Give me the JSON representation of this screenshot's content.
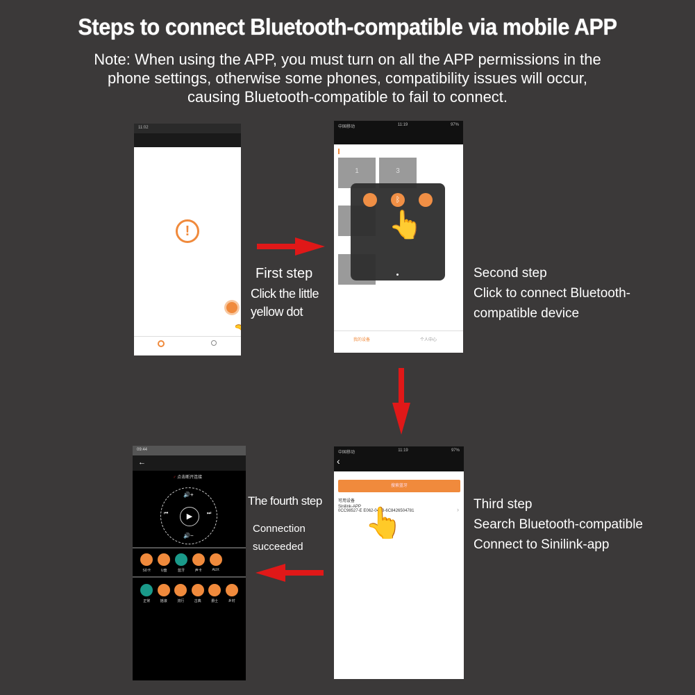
{
  "title": "Steps to connect Bluetooth-compatible via mobile APP",
  "note": [
    "Note: When using the APP, you must turn on all the APP permissions in the",
    "phone settings, otherwise some phones, compatibility issues will occur,",
    "causing Bluetooth-compatible to fail to connect."
  ],
  "steps": {
    "first": {
      "title": "First step",
      "lines": [
        "Click the little",
        "yellow dot"
      ]
    },
    "second": {
      "title": "Second step",
      "lines": [
        "Click to connect Bluetooth-",
        "compatible device"
      ]
    },
    "third": {
      "title": "Third step",
      "lines": [
        "Search Bluetooth-compatible",
        "Connect to Sinilink-app"
      ]
    },
    "fourth": {
      "title": "The fourth step",
      "lines": [
        "Connection",
        "succeeded"
      ]
    }
  },
  "phone1": {
    "status_time": "11:02",
    "icon": "exclamation-icon"
  },
  "phone2": {
    "carrier": "中国移动",
    "time": "11:19",
    "battery": "97%",
    "tiles": [
      "1",
      "3"
    ],
    "nav": [
      "我的设备",
      "个人中心"
    ]
  },
  "phone3": {
    "carrier": "中国移动",
    "time": "11:19",
    "battery": "97%",
    "search_button": "搜索蓝牙",
    "section": "可用设备",
    "device_name": "Sinilink-APP",
    "device_id": "0CC98527-E   E062-04A8-6C8426504781"
  },
  "phone4": {
    "time": "09:44",
    "disconnect": "点击断开连接",
    "sources": [
      "SD卡",
      "U盘",
      "蓝牙",
      "声卡",
      "AUX"
    ],
    "eq": [
      "正常",
      "摇滚",
      "流行",
      "古典",
      "爵士",
      "乡村"
    ]
  },
  "colors": {
    "accent": "#f08a3c",
    "arrow": "#e01818",
    "teal": "#1a9a8a",
    "background": "#3b3939"
  }
}
